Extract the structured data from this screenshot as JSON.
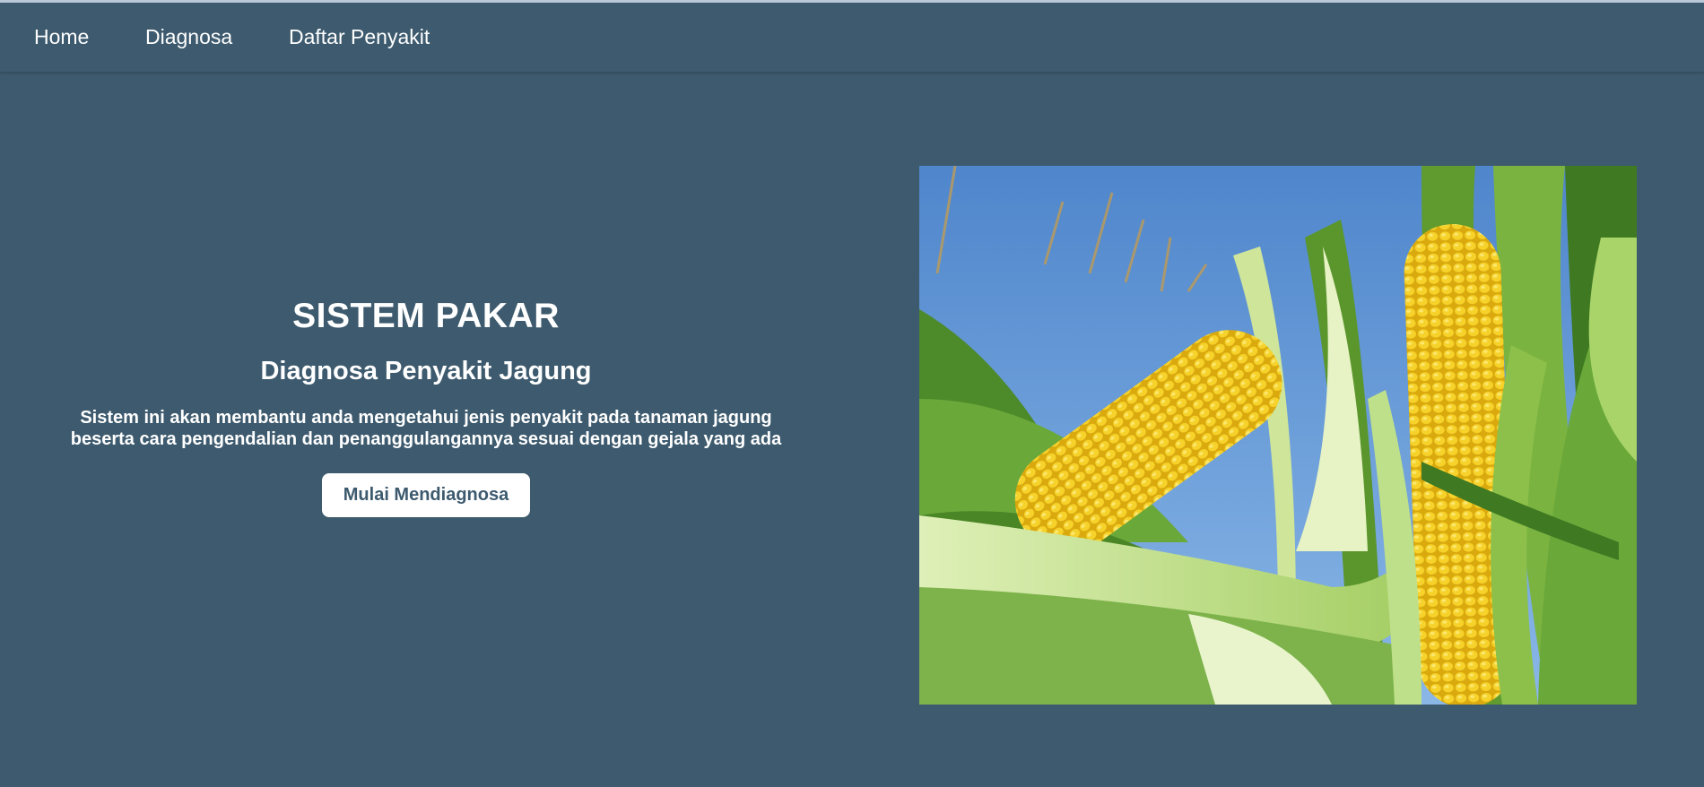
{
  "nav": {
    "items": [
      {
        "label": "Home"
      },
      {
        "label": "Diagnosa"
      },
      {
        "label": "Daftar Penyakit"
      }
    ]
  },
  "hero": {
    "title": "SISTEM PAKAR",
    "subtitle": "Diagnosa Penyakit Jagung",
    "description_line1": "Sistem ini akan membantu anda mengetahui jenis penyakit pada tanaman jagung",
    "description_line2": "beserta cara pengendalian dan penanggulangannya sesuai dengan gejala yang ada",
    "button_label": "Mulai Mendiagnosa"
  },
  "image": {
    "subject": "corn-cobs-photo"
  },
  "colors": {
    "background": "#3d5a6e",
    "button_bg": "#ffffff",
    "button_text": "#3d5a6e",
    "sky": "#5b8fd0",
    "corn": "#f2c820",
    "leaf": "#5f9b2e"
  }
}
